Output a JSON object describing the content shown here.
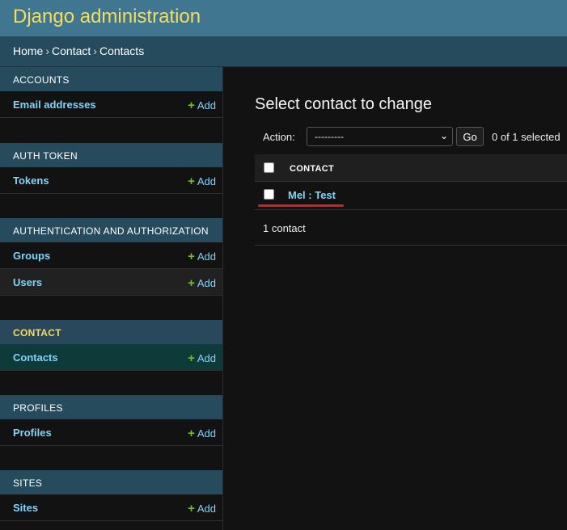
{
  "header": {
    "title": "Django administration"
  },
  "breadcrumbs": {
    "home": "Home",
    "app": "Contact",
    "current": "Contacts",
    "separator": "›"
  },
  "sidebar": {
    "add_label": "Add",
    "add_icon": "plus-icon",
    "modules": [
      {
        "caption": "ACCOUNTS",
        "models": [
          {
            "label": "Email addresses"
          }
        ]
      },
      {
        "caption": "AUTH TOKEN",
        "models": [
          {
            "label": "Tokens"
          }
        ]
      },
      {
        "caption": "AUTHENTICATION AND AUTHORIZATION",
        "models": [
          {
            "label": "Groups"
          },
          {
            "label": "Users"
          }
        ]
      },
      {
        "caption": "CONTACT",
        "current": true,
        "models": [
          {
            "label": "Contacts",
            "current": true
          }
        ]
      },
      {
        "caption": "PROFILES",
        "models": [
          {
            "label": "Profiles"
          }
        ]
      },
      {
        "caption": "SITES",
        "models": [
          {
            "label": "Sites"
          }
        ]
      }
    ]
  },
  "main": {
    "title": "Select contact to change",
    "actions": {
      "label": "Action:",
      "selected_value": "---------",
      "go_label": "Go",
      "counter": "0 of 1 selected"
    },
    "table": {
      "column_header": "CONTACT",
      "rows": [
        {
          "label": "Mel : Test"
        }
      ]
    },
    "paginator": "1 contact"
  },
  "colors": {
    "header_bg": "#417690",
    "title_yellow": "#f5dd5d",
    "link_blue": "#81d4fa",
    "add_green": "#70bf2b",
    "highlight_red": "#d61f1f"
  }
}
